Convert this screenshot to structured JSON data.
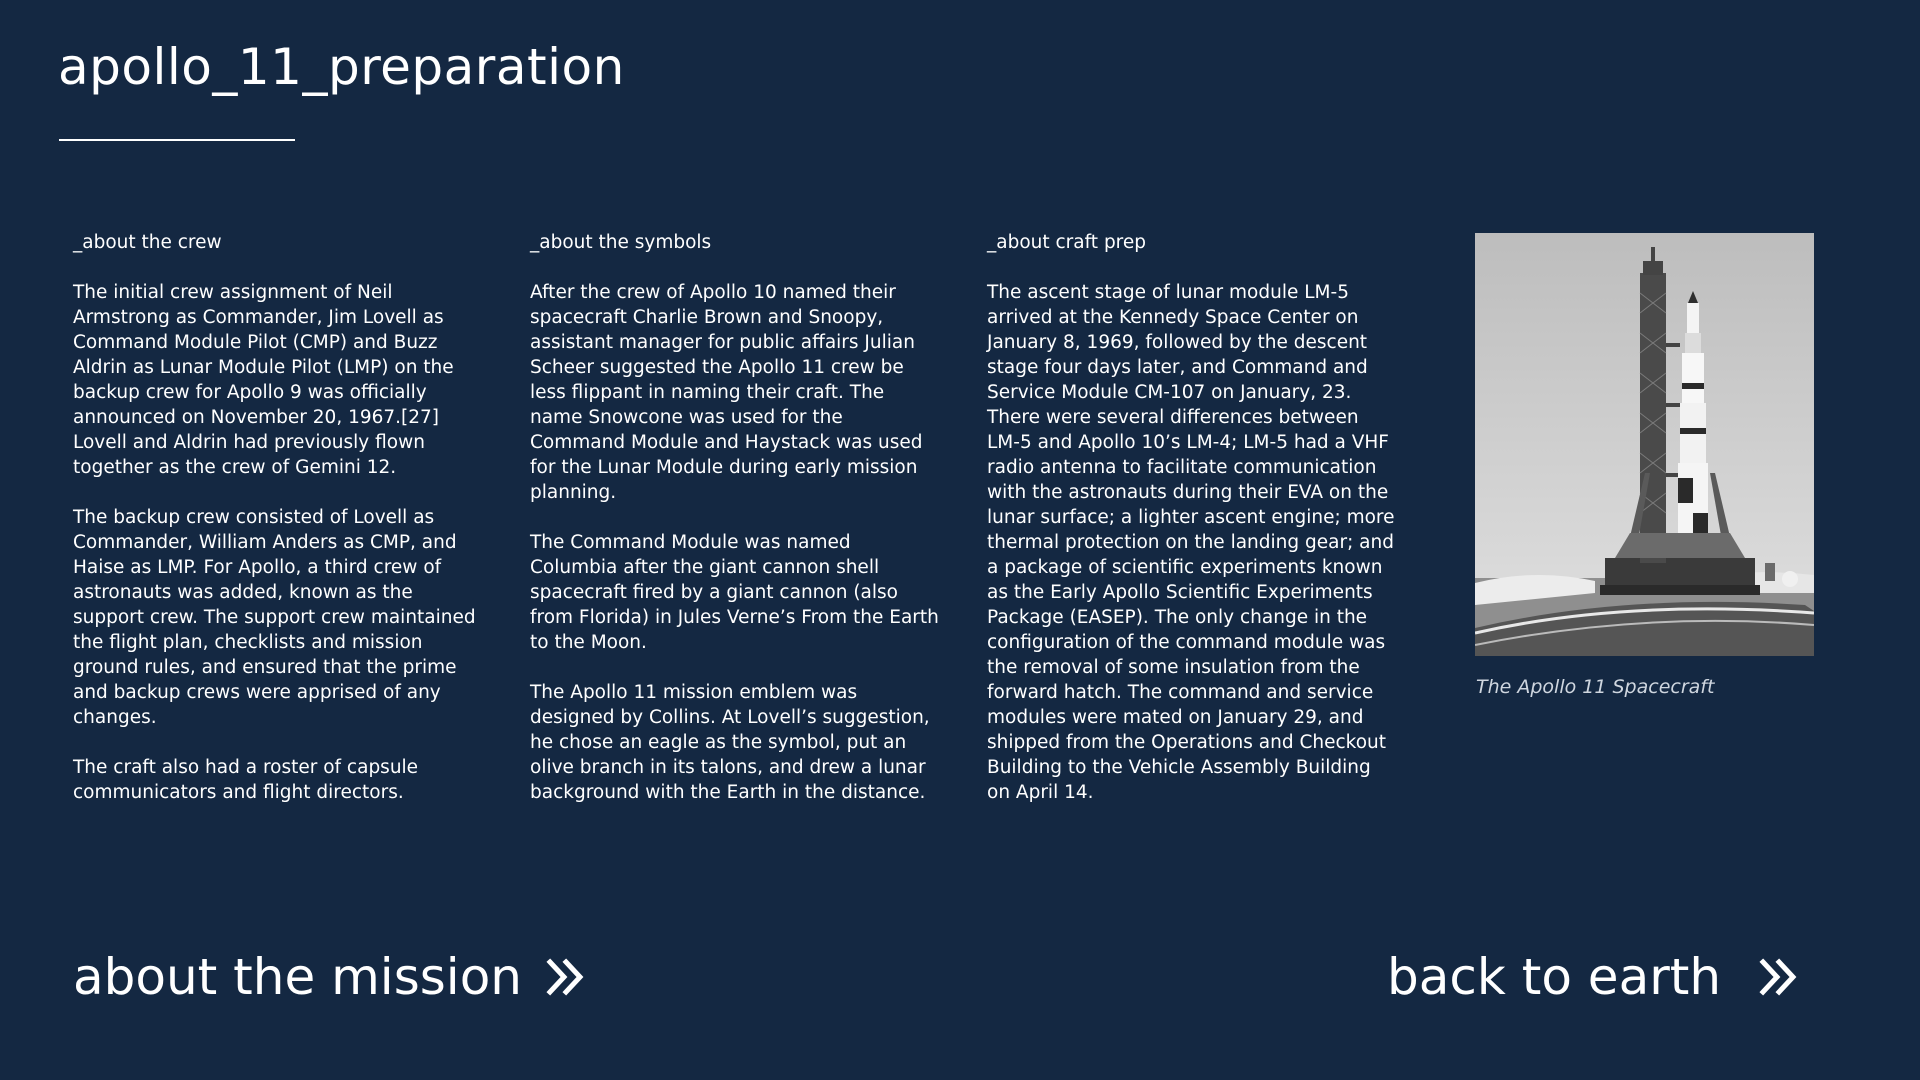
{
  "page": {
    "title": "apollo_11_preparation"
  },
  "columns": [
    {
      "heading": "_about the crew",
      "paragraphs": [
        "The initial crew assignment of Neil Armstrong as Commander, Jim Lovell as Command Module Pilot (CMP) and Buzz Aldrin as Lunar Module Pilot (LMP) on the backup crew for Apollo 9 was officially announced on November 20, 1967.[27] Lovell and Aldrin had previously flown together as the crew of Gemini 12.",
        "The backup crew consisted of Lovell as Commander, William Anders as CMP, and Haise as LMP. For Apollo, a third crew of astronauts was added, known as the support crew. The support crew maintained the flight plan, checklists and mission ground rules, and ensured that the prime and backup crews were apprised of any changes.",
        "The craft also had a roster of capsule communicators and flight directors."
      ]
    },
    {
      "heading": "_about the symbols",
      "paragraphs": [
        "After the crew of Apollo 10 named their spacecraft Charlie Brown and Snoopy, assistant manager for public affairs Julian Scheer suggested the Apollo 11 crew be less flippant in naming their craft. The name Snowcone was used for the Command Module and Haystack was used for the Lunar Module during early mission planning.",
        "The Command Module was named Columbia after the giant cannon shell spacecraft fired by a giant cannon (also from Florida) in Jules Verne’s From the Earth to the Moon.",
        "The Apollo 11 mission emblem was designed by Collins. At Lovell’s suggestion, he chose an eagle as the symbol, put an olive branch in its talons, and drew a lunar background with the Earth in the distance."
      ]
    },
    {
      "heading": "_about craft prep",
      "paragraphs": [
        "The ascent stage of lunar module LM-5 arrived at the Kennedy Space Center on January 8, 1969, followed by the descent stage four days later, and Command and Service Module CM-107 on January, 23. There were several differences between LM-5 and Apollo 10’s LM-4; LM-5 had a VHF radio antenna to facilitate communication with the astronauts during their EVA on the lunar surface; a lighter ascent engine; more thermal protection on the landing gear; and a package of scientific experiments known as the Early Apollo Scientific Experiments Package (EASEP). The only change in the configuration of the command module was the removal of some insulation from the forward hatch. The command and service modules were mated on January 29, and shipped from the Operations and Checkout Building to the Vehicle Assembly Building on April 14."
      ]
    }
  ],
  "figure": {
    "caption": "The Apollo 11 Spacecraft"
  },
  "nav": {
    "mission_label": "about the mission",
    "earth_label": "back to earth",
    "icon": "double-chevron-right-icon"
  },
  "colors": {
    "background": "#142842",
    "text": "#ffffff",
    "caption": "#cfd6df"
  }
}
